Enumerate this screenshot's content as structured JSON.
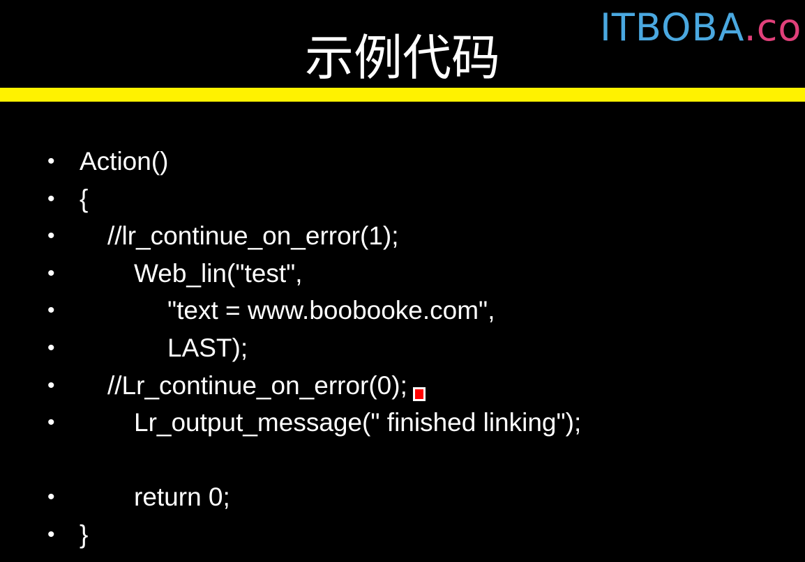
{
  "logo": {
    "main": "ITBOBA",
    "dot": ".",
    "tld": "co"
  },
  "slide": {
    "title": "示例代码",
    "bullet_symbol": "•",
    "lines": [
      "Action()",
      "{",
      "//lr_continue_on_error(1);",
      "Web_lin(\"test\",",
      "\"text = www.boobooke.com\",",
      "LAST);",
      "//Lr_continue_on_error(0);",
      "Lr_output_message(\" finished linking\");",
      "return 0;",
      "}"
    ]
  },
  "colors": {
    "background": "#000000",
    "rule": "#fff200",
    "text": "#ffffff",
    "logo_blue": "#4aa8e0",
    "logo_pink": "#e0407a",
    "cursor": "#ff0000"
  }
}
